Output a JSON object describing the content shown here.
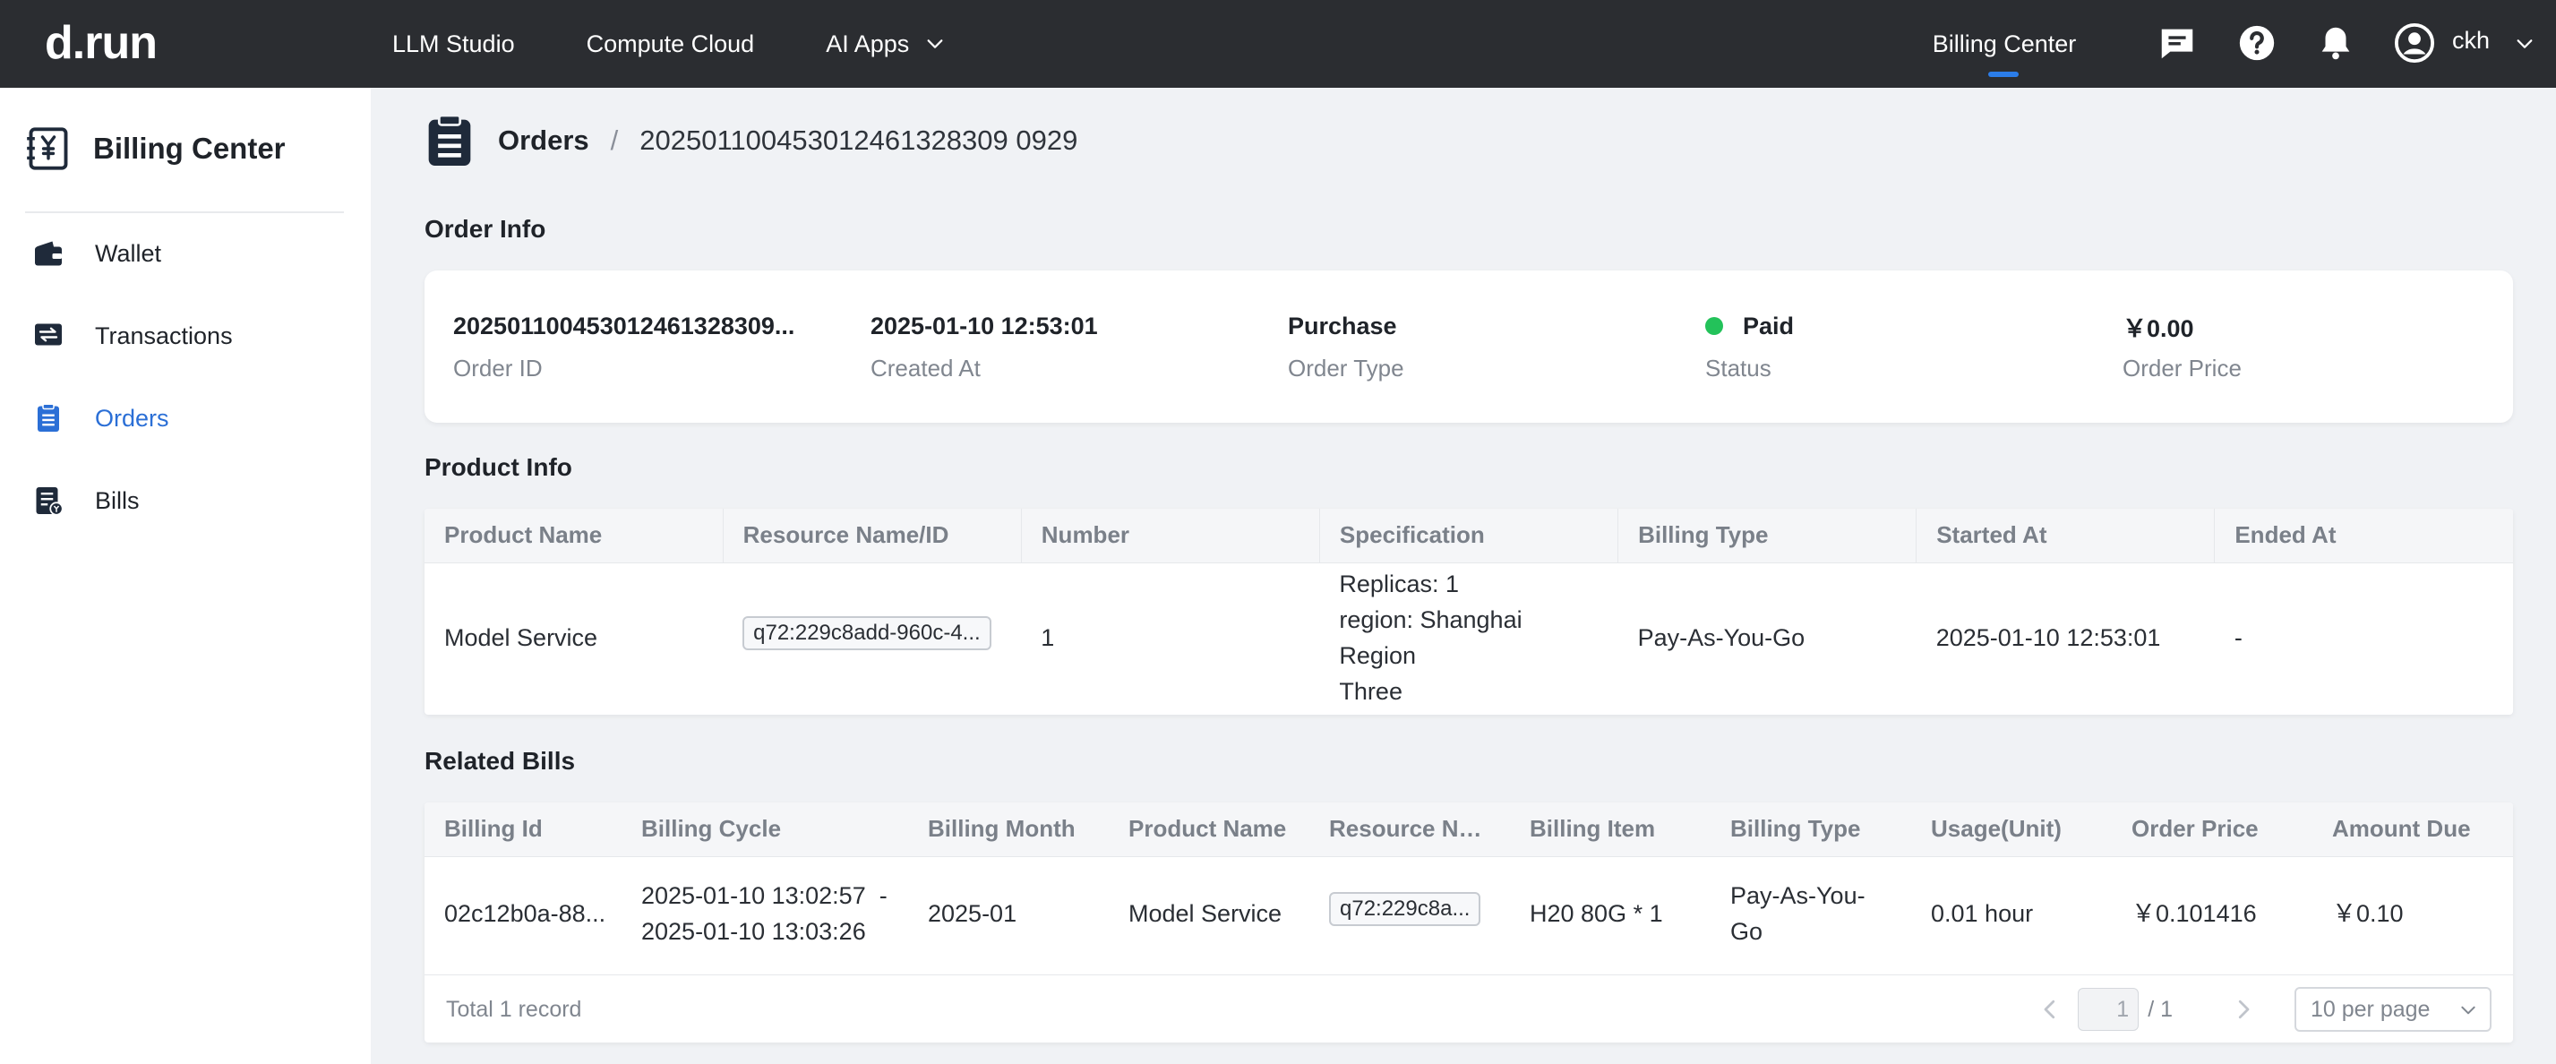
{
  "brand": {
    "logo_text": "d.run"
  },
  "topnav": {
    "items": [
      {
        "label": "LLM Studio"
      },
      {
        "label": "Compute Cloud"
      },
      {
        "label": "AI Apps"
      }
    ],
    "billing_center": "Billing Center",
    "user": "ckh",
    "icons": [
      "message-icon",
      "help-icon",
      "bell-icon",
      "user-avatar-icon"
    ]
  },
  "sidebar": {
    "title": "Billing Center",
    "items": [
      {
        "label": "Wallet",
        "icon": "wallet-icon"
      },
      {
        "label": "Transactions",
        "icon": "transactions-icon"
      },
      {
        "label": "Orders",
        "icon": "orders-icon",
        "active": true
      },
      {
        "label": "Bills",
        "icon": "bills-icon"
      }
    ]
  },
  "breadcrumb": {
    "parent": "Orders",
    "separator": "/",
    "current": "202501100453012461328309 0929"
  },
  "order_info": {
    "section_title": "Order Info",
    "order_id": {
      "value": "2025011004530124613283​09...",
      "label": "Order ID"
    },
    "created_at": {
      "value": "2025-01-10 12:53:01",
      "label": "Created At"
    },
    "order_type": {
      "value": "Purchase",
      "label": "Order Type"
    },
    "status": {
      "value": "Paid",
      "label": "Status",
      "color": "#23c25a"
    },
    "order_price": {
      "value": "￥0.00",
      "label": "Order Price"
    }
  },
  "product_info": {
    "section_title": "Product Info",
    "columns": [
      "Product Name",
      "Resource Name/ID",
      "Number",
      "Specification",
      "Billing Type",
      "Started At",
      "Ended At"
    ],
    "row": {
      "product_name": "Model Service",
      "resource": "q72:229c8add-960c-4...",
      "number": "1",
      "spec_line1": "Replicas: 1",
      "spec_line2": "region: Shanghai Region",
      "spec_line3": "Three",
      "billing_type": "Pay-As-You-Go",
      "started_at": "2025-01-10 12:53:01",
      "ended_at": "-"
    }
  },
  "related_bills": {
    "section_title": "Related Bills",
    "columns": [
      "Billing Id",
      "Billing Cycle",
      "Billing Month",
      "Product Name",
      "Resource Na...",
      "Billing Item",
      "Billing Type",
      "Usage(Unit)",
      "Order Price",
      "Amount Due"
    ],
    "row": {
      "billing_id": "02c12b0a-88...",
      "cycle_start": "2025-01-10 13:02:57  -",
      "cycle_end": "2025-01-10 13:03:26",
      "billing_month": "2025-01",
      "product_name": "Model Service",
      "resource": "q72:229c8a...",
      "billing_item": "H20 80G * 1",
      "billing_type": "Pay-As-You-Go",
      "usage": "0.01 hour",
      "order_price": "￥0.101416",
      "amount_due": "￥0.10"
    },
    "footer": {
      "total": "Total 1 record",
      "page": "1",
      "page_total": "/ 1",
      "page_size": "10 per page"
    }
  },
  "colors": {
    "accent": "#2b7de9",
    "topbar": "#2b2d31",
    "paid": "#23c25a"
  }
}
